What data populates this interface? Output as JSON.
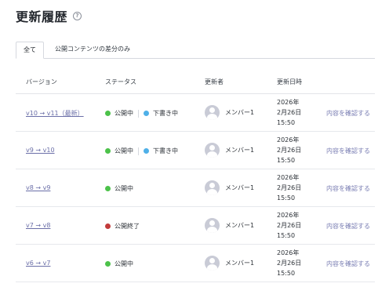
{
  "page": {
    "title": "更新履歴",
    "help_icon": "?"
  },
  "tabs": [
    {
      "label": "全て",
      "active": true
    },
    {
      "label": "公開コンテンツの差分のみ",
      "active": false
    }
  ],
  "table": {
    "headers": {
      "version": "バージョン",
      "status": "ステータス",
      "updater": "更新者",
      "updated_at": "更新日時"
    },
    "rows": [
      {
        "version": "v10 → v11（最新）",
        "statuses": [
          {
            "label": "公開中",
            "color": "#4cc24a"
          },
          {
            "label": "下書き中",
            "color": "#4fb0e8"
          }
        ],
        "updater": "メンバー1",
        "date_year": "2026年",
        "date_day": "2月26日",
        "date_time": "15:50",
        "action": "内容を確認する"
      },
      {
        "version": "v9 → v10",
        "statuses": [
          {
            "label": "公開中",
            "color": "#4cc24a"
          },
          {
            "label": "下書き中",
            "color": "#4fb0e8"
          }
        ],
        "updater": "メンバー1",
        "date_year": "2026年",
        "date_day": "2月26日",
        "date_time": "15:50",
        "action": "内容を確認する"
      },
      {
        "version": "v8 → v9",
        "statuses": [
          {
            "label": "公開中",
            "color": "#4cc24a"
          }
        ],
        "updater": "メンバー1",
        "date_year": "2026年",
        "date_day": "2月26日",
        "date_time": "15:50",
        "action": "内容を確認する"
      },
      {
        "version": "v7 → v8",
        "statuses": [
          {
            "label": "公開終了",
            "color": "#c23b3b"
          }
        ],
        "updater": "メンバー1",
        "date_year": "2026年",
        "date_day": "2月26日",
        "date_time": "15:50",
        "action": "内容を確認する"
      },
      {
        "version": "v6 → v7",
        "statuses": [
          {
            "label": "公開中",
            "color": "#4cc24a"
          }
        ],
        "updater": "メンバー1",
        "date_year": "2026年",
        "date_day": "2月26日",
        "date_time": "15:50",
        "action": "内容を確認する"
      }
    ]
  },
  "icons": {
    "help": "help-circle-icon",
    "avatar": "user-avatar-icon"
  }
}
